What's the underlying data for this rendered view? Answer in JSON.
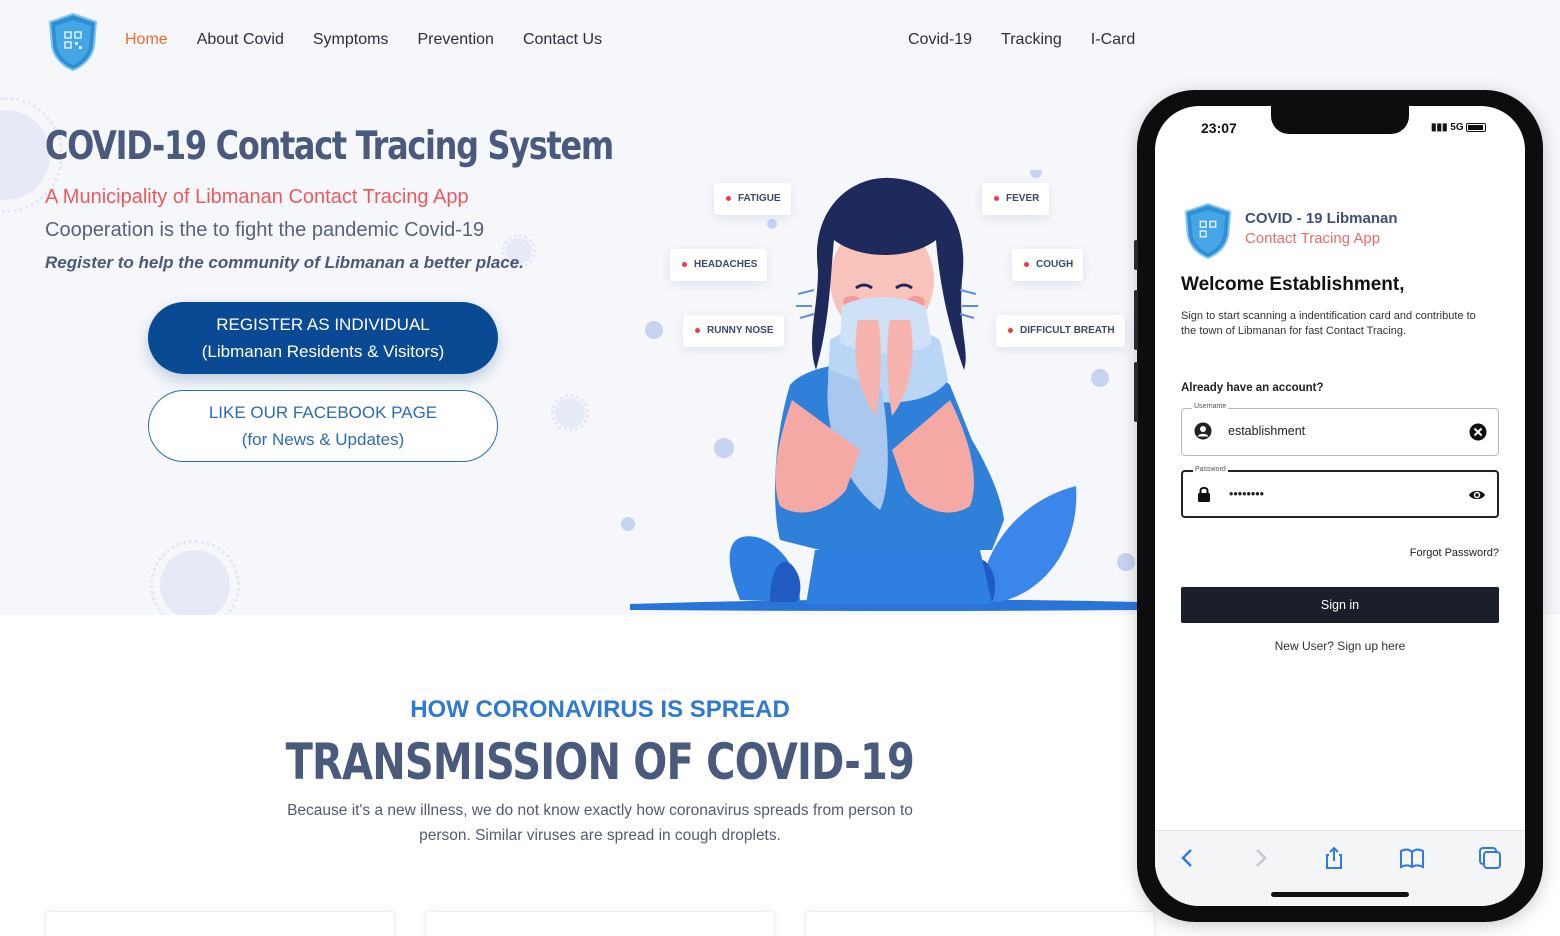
{
  "nav": {
    "left": [
      "Home",
      "About Covid",
      "Symptoms",
      "Prevention",
      "Contact Us"
    ],
    "right": [
      "Covid-19",
      "Tracking",
      "I-Card"
    ],
    "active": "Home",
    "active_color": "#ee6c2c"
  },
  "hero": {
    "title": "COVID-19 Contact Tracing System",
    "subtitle": "A Municipality of Libmanan Contact Tracing App",
    "description": "Cooperation is the to fight the pandemic Covid-19",
    "emphasis": "Register to help the community of Libmanan a better place.",
    "register_line1": "REGISTER AS INDIVIDUAL",
    "register_line2": "(Libmanan Residents & Visitors)",
    "facebook_line1": "LIKE OUR FACEBOOK PAGE",
    "facebook_line2": "(for News & Updates)"
  },
  "symptoms": [
    "FATIGUE",
    "FEVER",
    "HEADACHES",
    "COUGH",
    "RUNNY NOSE",
    "DIFFICULT BREATH"
  ],
  "phone": {
    "time": "23:07",
    "network": "5G",
    "app_title": "COVID - 19 Libmanan",
    "app_subtitle": "Contact Tracing App",
    "welcome": "Welcome Establishment,",
    "welcome_desc": "Sign to start scanning a indentification card and contribute to the town of Libmanan for fast Contact Tracing.",
    "already": "Already have an account?",
    "username_label": "Username",
    "username_value": "establishment",
    "password_label": "Password",
    "password_value": "••••••••",
    "forgot": "Forgot Password?",
    "signin": "Sign in",
    "newuser": "New User? Sign up here"
  },
  "section": {
    "eyebrow": "HOW CORONAVIRUS IS SPREAD",
    "title": "TRANSMISSION OF COVID-19",
    "description": "Because it's a new illness, we do not know exactly how coronavirus spreads from person to person. Similar viruses are spread in cough droplets."
  },
  "colors": {
    "brand_blue": "#0a4a94",
    "accent_red": "#ec5a5f",
    "heading": "#4a5a7d",
    "eyebrow_blue": "#2f7ad0"
  }
}
